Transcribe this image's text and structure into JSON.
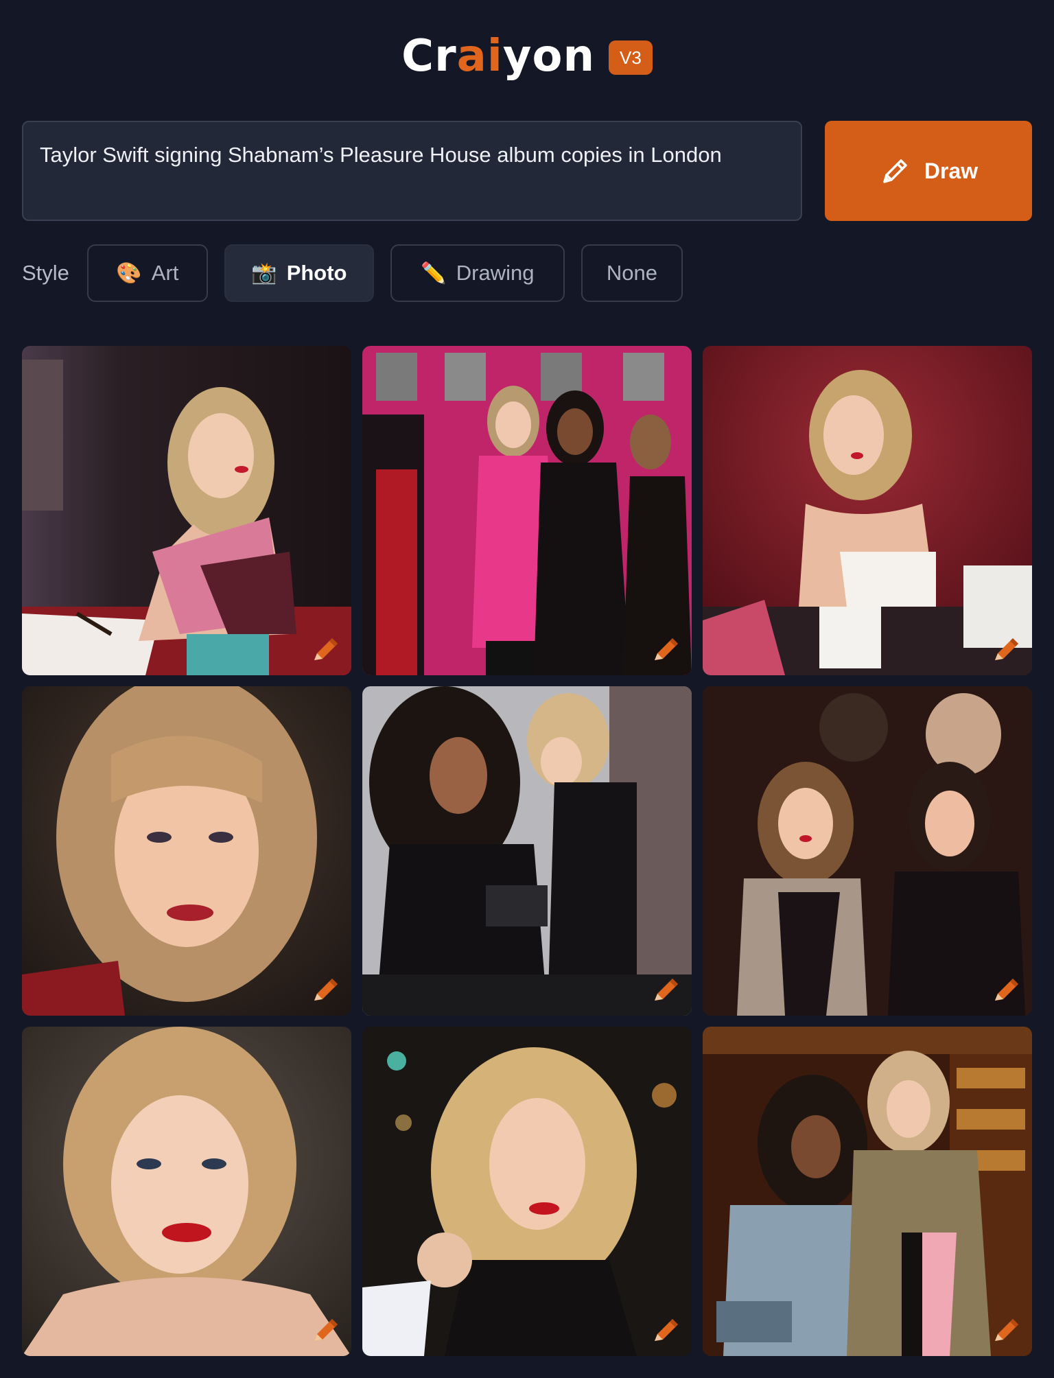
{
  "header": {
    "logo_prefix": "Cr",
    "logo_accent": "ai",
    "logo_suffix": "yon",
    "version": "V3"
  },
  "prompt": {
    "text": "Taylor Swift signing Shabnam’s Pleasure House album copies in London"
  },
  "draw_button": {
    "label": "Draw",
    "icon": "pencil-icon"
  },
  "style": {
    "label": "Style",
    "options": [
      {
        "label": "Art",
        "icon": "palette-icon",
        "emoji": "🎨"
      },
      {
        "label": "Photo",
        "icon": "camera-flash-icon",
        "emoji": "📸"
      },
      {
        "label": "Drawing",
        "icon": "pencil-icon",
        "emoji": "✏️"
      },
      {
        "label": "None",
        "icon": "",
        "emoji": ""
      }
    ],
    "selected": "Photo"
  },
  "colors": {
    "background": "#141826",
    "accent": "#d45d17",
    "input_bg": "#232838"
  },
  "results": {
    "count": 9,
    "tile_badge_icon": "edit-pencil-icon"
  }
}
